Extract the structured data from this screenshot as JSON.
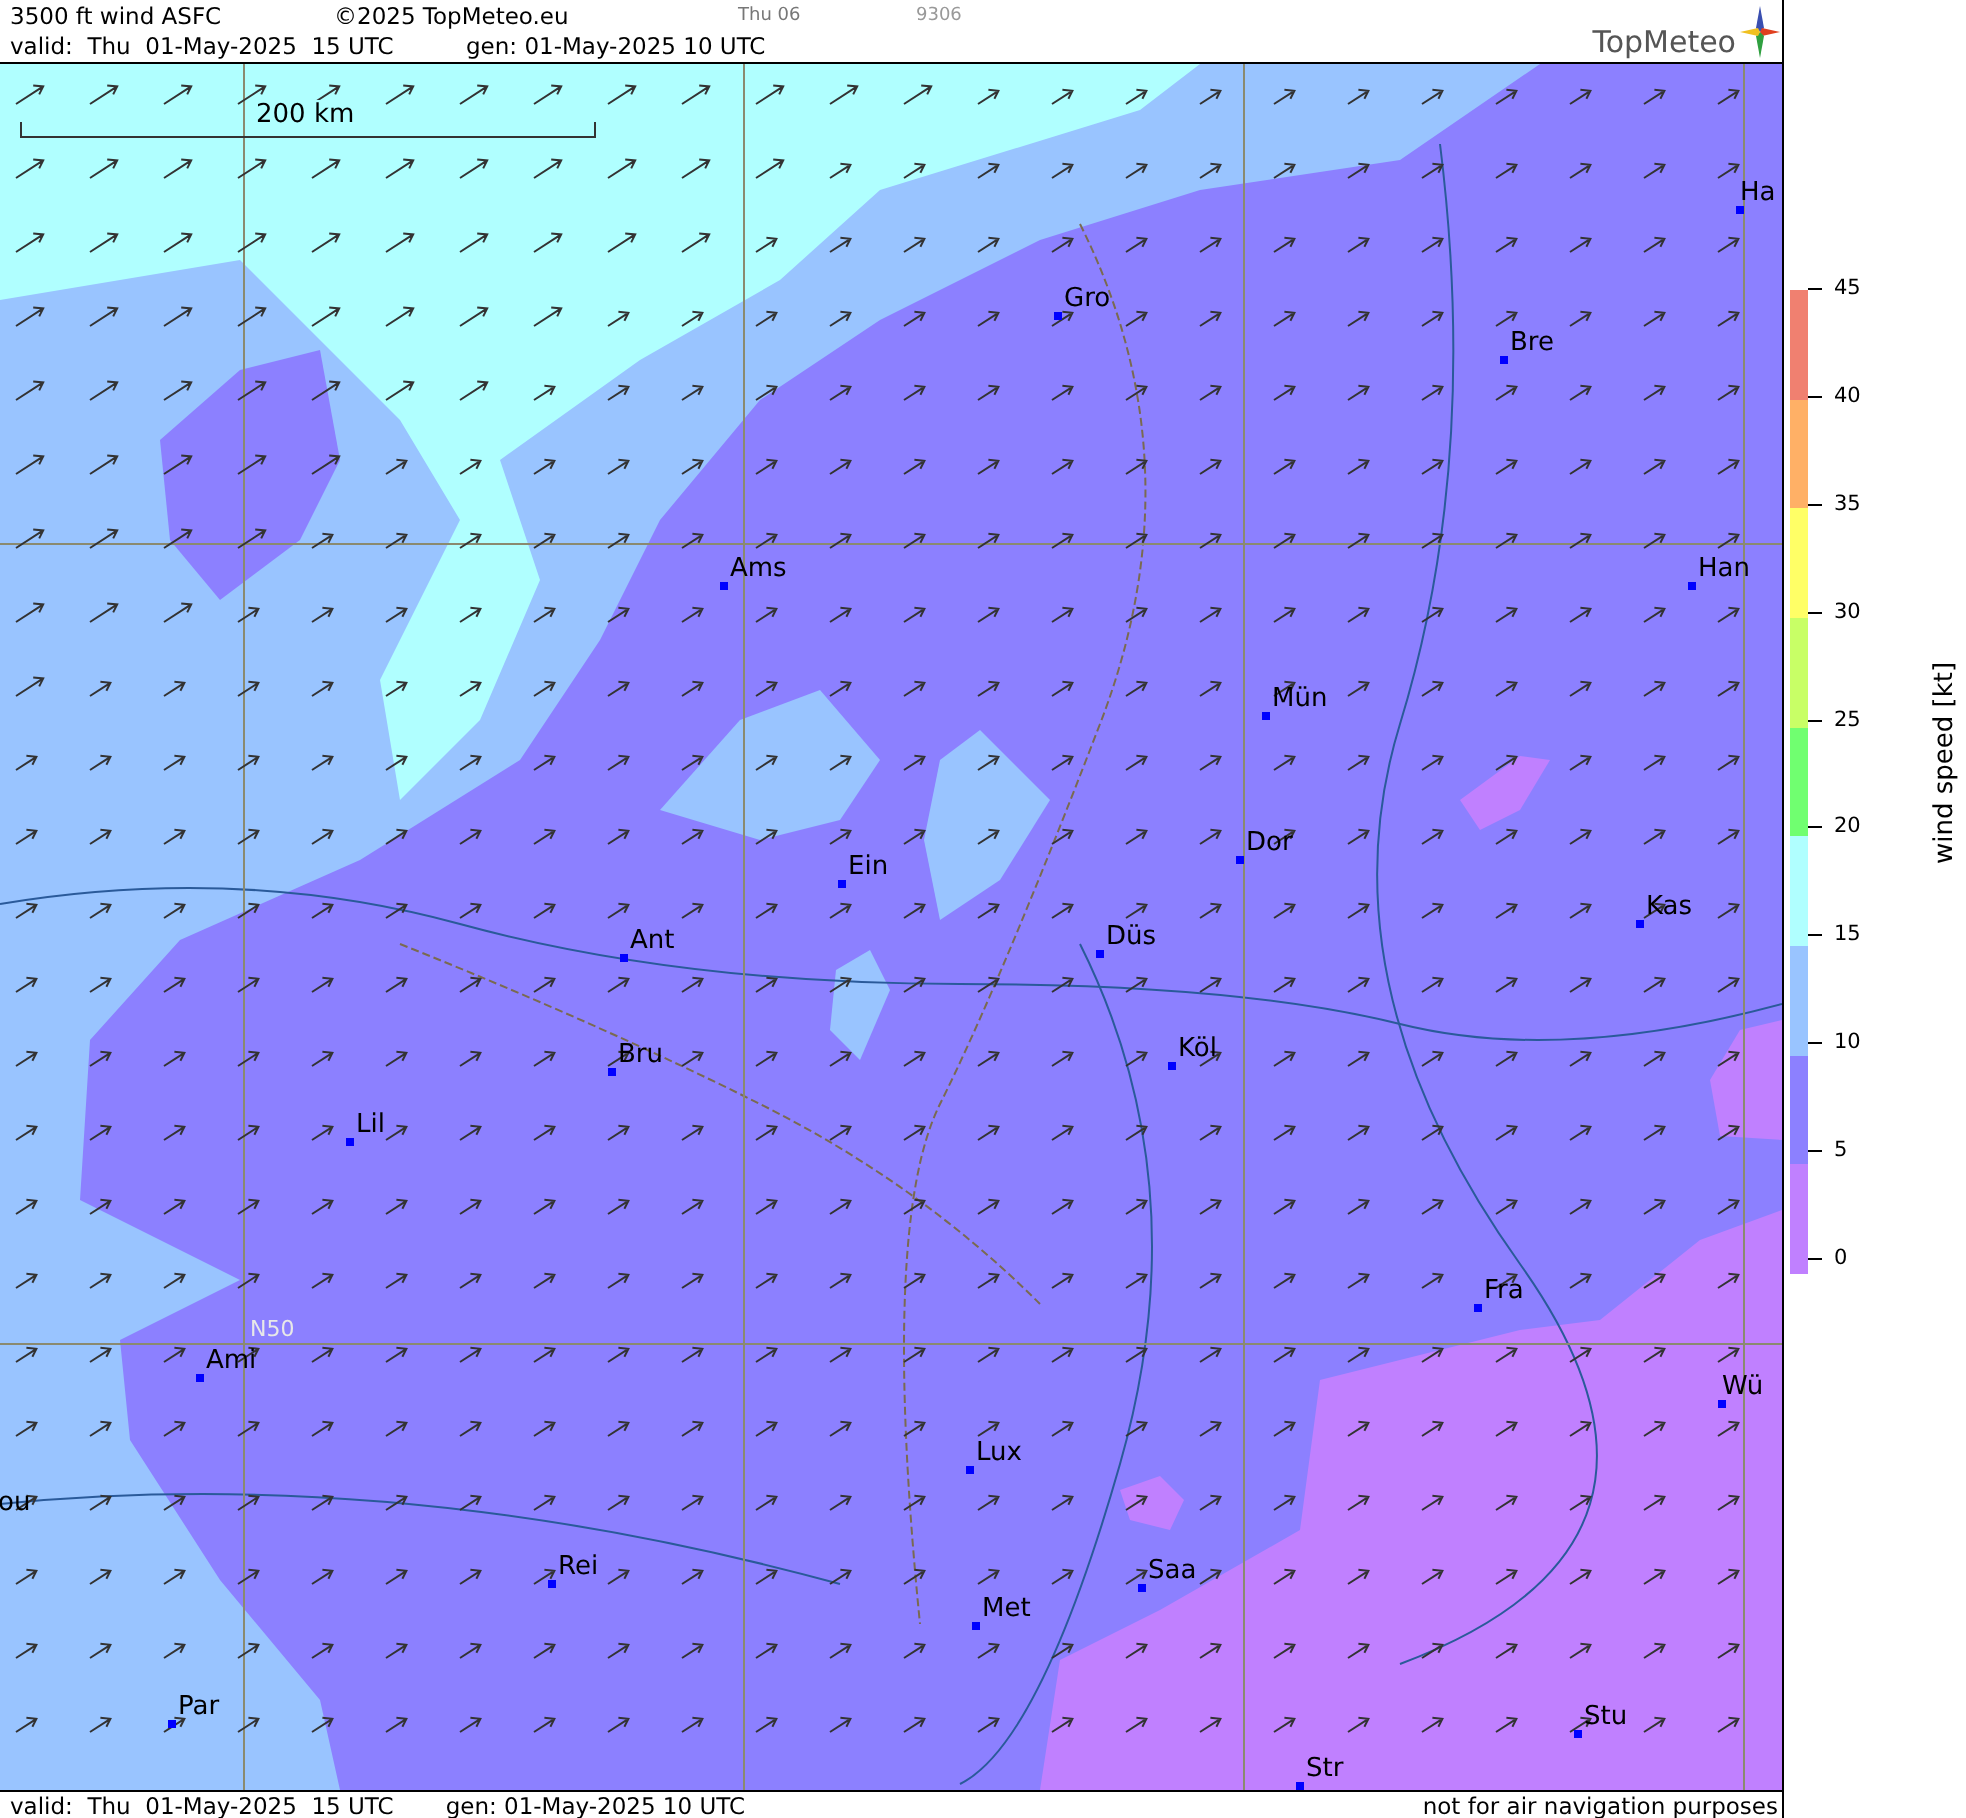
{
  "header": {
    "title": "3500 ft wind ASFC",
    "copyright": "©2025 TopMeteo.eu",
    "day": "Thu 06",
    "code": "9306",
    "valid": "valid:  Thu  01-May-2025  15 UTC",
    "generated": "gen: 01-May-2025 10 UTC",
    "logo": "TopMeteo"
  },
  "map": {
    "scale": "200 km",
    "grid_label": "N50",
    "cities": [
      "Ha",
      "Gro",
      "Bre",
      "Ams",
      "Han",
      "Mün",
      "Dor",
      "Ein",
      "Kas",
      "Düs",
      "Ant",
      "Köl",
      "Bru",
      "Lil",
      "Fra",
      "Ami",
      "Wü",
      "Lux",
      "ou",
      "Rei",
      "Saa",
      "Met",
      "Par",
      "Stu",
      "Str"
    ]
  },
  "legend": {
    "title": "wind speed [kt]",
    "ticks": [
      "45",
      "40",
      "35",
      "30",
      "25",
      "20",
      "15",
      "10",
      "5",
      "0"
    ],
    "bands": [
      {
        "color": "#f08070"
      },
      {
        "color": "#ffb066"
      },
      {
        "color": "#ffff66"
      },
      {
        "color": "#c8ff66"
      },
      {
        "color": "#70ff70"
      },
      {
        "color": "#b0ffff"
      },
      {
        "color": "#99c4ff"
      },
      {
        "color": "#8c80ff"
      },
      {
        "color": "#c080ff"
      }
    ]
  },
  "footer": {
    "valid": "valid:  Thu  01-May-2025  15 UTC",
    "generated": "gen: 01-May-2025 10 UTC",
    "notice": "not for air navigation purposes"
  }
}
